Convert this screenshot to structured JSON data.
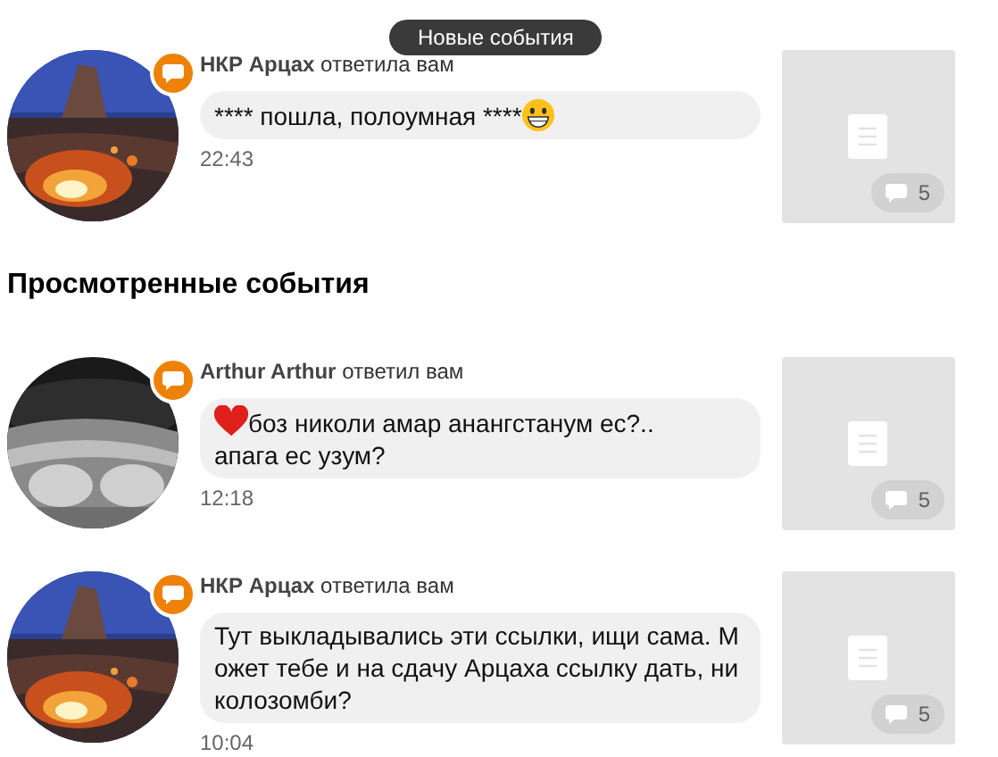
{
  "new_events_pill": "Новые события",
  "sections": [
    {
      "events": [
        {
          "author": "НКР Арцах",
          "action": "ответила вам",
          "message": {
            "kind": "trailing_emoji",
            "lines": [
              "**** пошла, полоумная ****"
            ]
          },
          "time": "22:43",
          "comments": "5"
        }
      ]
    },
    {
      "title": "Просмотренные события",
      "events": [
        {
          "author": "Arthur Arthur",
          "action": "ответил вам",
          "message": {
            "kind": "leading_emoji",
            "lines": [
              "боз николи амар анангстанум ес?..",
              "апага ес узум?"
            ]
          },
          "time": "12:18",
          "comments": "5"
        },
        {
          "author": "НКР Арцах",
          "action": "ответила вам",
          "message": {
            "kind": "plain",
            "lines": [
              "Тут выкладывались эти ссылки, ищи сама. М",
              "ожет тебе и на сдачу Арцаха ссылку дать, ни",
              "колозомби?"
            ]
          },
          "time": "10:04",
          "comments": "5"
        }
      ]
    }
  ]
}
